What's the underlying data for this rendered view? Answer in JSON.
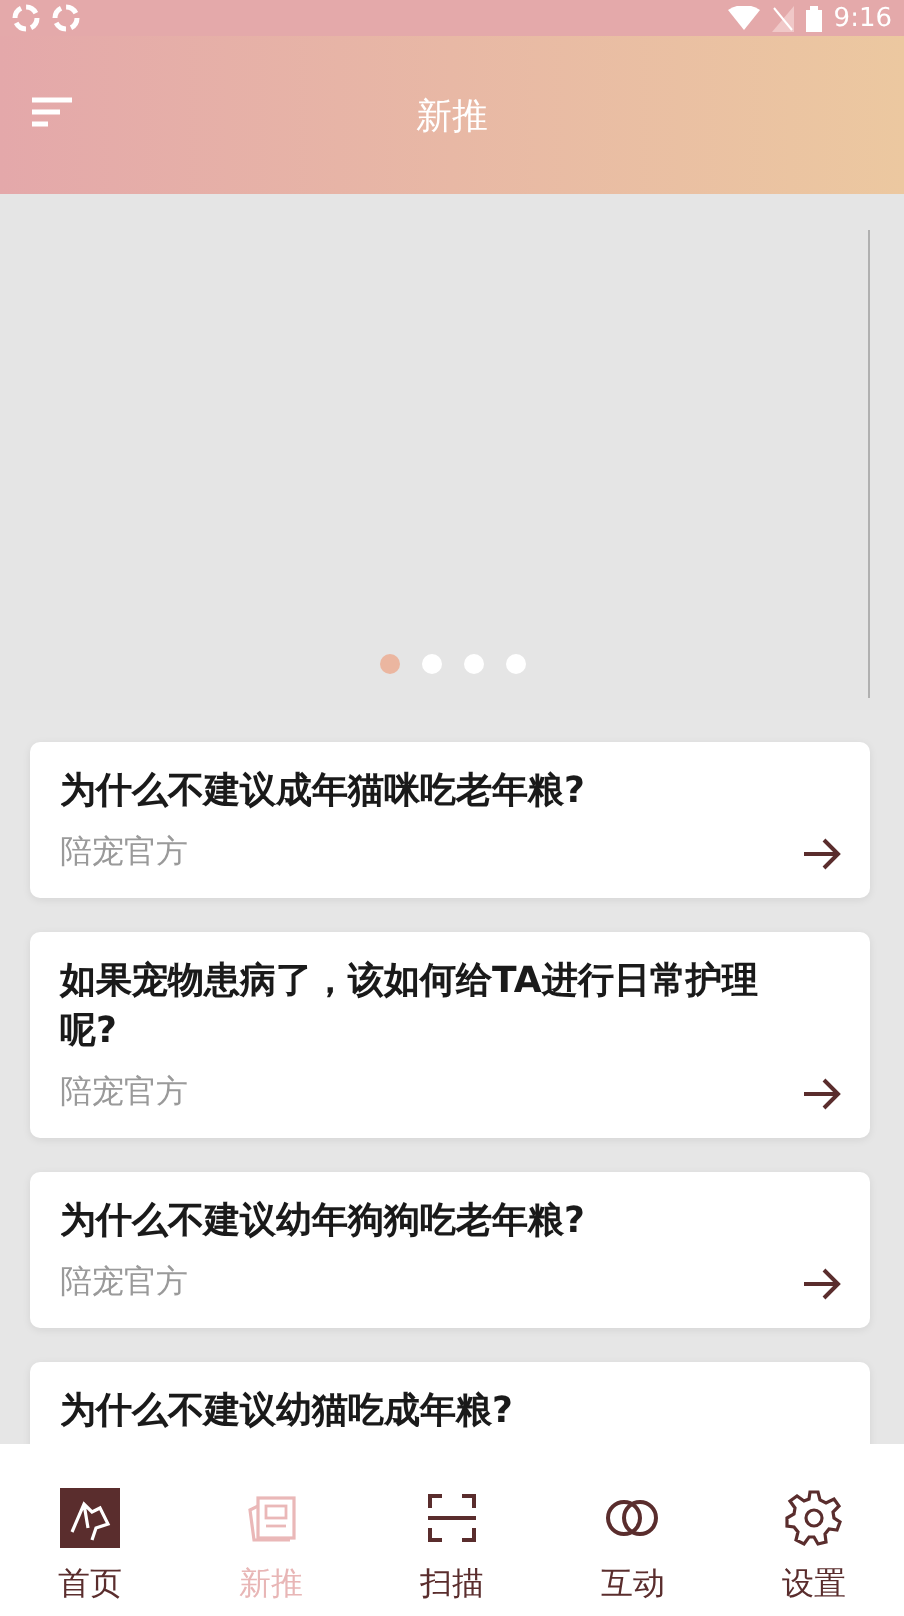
{
  "status_bar": {
    "time": "9:16"
  },
  "header": {
    "title": "新推"
  },
  "banner": {
    "dots": [
      {
        "selected": true
      },
      {
        "selected": false
      },
      {
        "selected": false
      },
      {
        "selected": false
      }
    ]
  },
  "articles": [
    {
      "title": "为什么不建议成年猫咪吃老年粮?",
      "source": "陪宠官方"
    },
    {
      "title": "如果宠物患病了，该如何给TA进行日常护理呢?",
      "source": "陪宠官方"
    },
    {
      "title": "为什么不建议幼年狗狗吃老年粮?",
      "source": "陪宠官方"
    },
    {
      "title": "为什么不建议幼猫吃成年粮?"
    }
  ],
  "tab_bar": [
    {
      "kind": "home",
      "label": "首页",
      "selected": false
    },
    {
      "kind": "news",
      "label": "新推",
      "selected": true
    },
    {
      "kind": "scan",
      "label": "扫描",
      "selected": false
    },
    {
      "kind": "interact",
      "label": "互动",
      "selected": false
    },
    {
      "kind": "settings",
      "label": "设置",
      "selected": false
    }
  ]
}
